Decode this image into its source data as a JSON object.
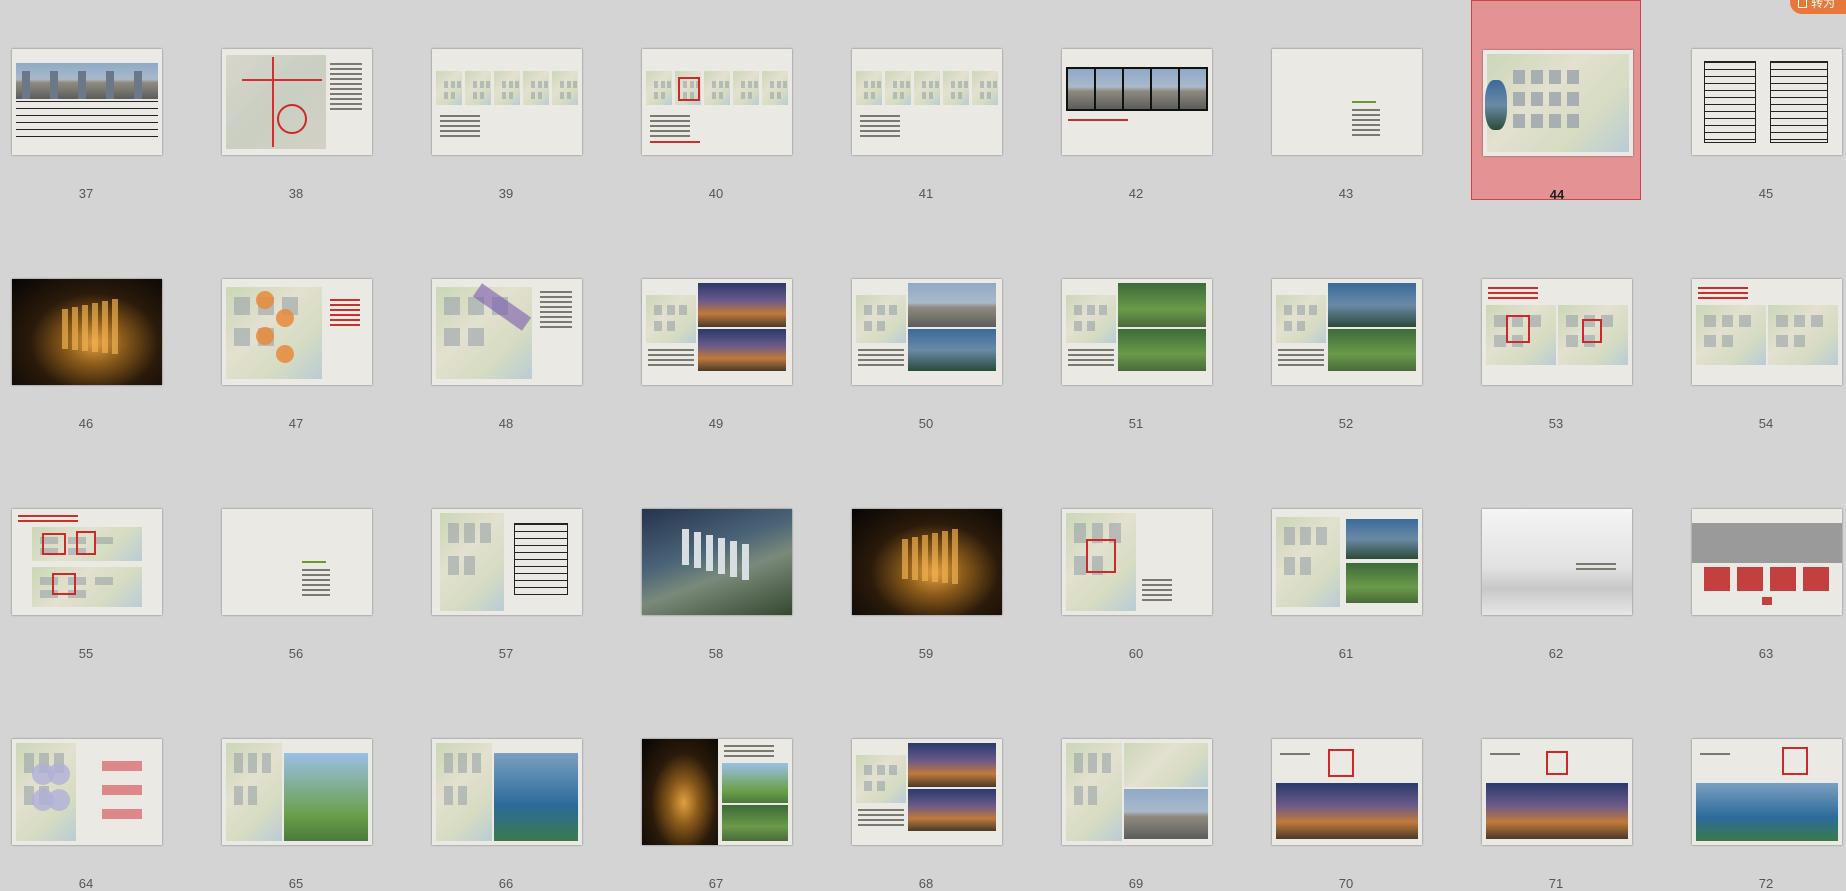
{
  "corner_button": {
    "label": "转为"
  },
  "selected_slide": "44",
  "slides": [
    {
      "number": "37",
      "kind": "towers-table"
    },
    {
      "number": "38",
      "kind": "road-map"
    },
    {
      "number": "39",
      "kind": "plan-strip"
    },
    {
      "number": "40",
      "kind": "plan-strip-red"
    },
    {
      "number": "41",
      "kind": "plan-strip"
    },
    {
      "number": "42",
      "kind": "towers-strip"
    },
    {
      "number": "43",
      "kind": "title-blank"
    },
    {
      "number": "44",
      "kind": "site-plan"
    },
    {
      "number": "45",
      "kind": "data-tables"
    },
    {
      "number": "46",
      "kind": "night-render"
    },
    {
      "number": "47",
      "kind": "diagram-circles"
    },
    {
      "number": "48",
      "kind": "diagram-arrows"
    },
    {
      "number": "49",
      "kind": "plan-photos-dusk"
    },
    {
      "number": "50",
      "kind": "plan-photos-water"
    },
    {
      "number": "51",
      "kind": "plan-photos-palms"
    },
    {
      "number": "52",
      "kind": "plan-photos-lake"
    },
    {
      "number": "53",
      "kind": "two-plans-red"
    },
    {
      "number": "54",
      "kind": "two-plans"
    },
    {
      "number": "55",
      "kind": "red-outline-plans"
    },
    {
      "number": "56",
      "kind": "title-blank"
    },
    {
      "number": "57",
      "kind": "plan-with-table"
    },
    {
      "number": "58",
      "kind": "aerial-render"
    },
    {
      "number": "59",
      "kind": "night-render"
    },
    {
      "number": "60",
      "kind": "plan-legend"
    },
    {
      "number": "61",
      "kind": "plan-photos-garden"
    },
    {
      "number": "62",
      "kind": "fog-title"
    },
    {
      "number": "63",
      "kind": "flow-diagram"
    },
    {
      "number": "64",
      "kind": "bubble-plan"
    },
    {
      "number": "65",
      "kind": "plan-photos-sport"
    },
    {
      "number": "66",
      "kind": "plan-photos-court"
    },
    {
      "number": "67",
      "kind": "night-plaza"
    },
    {
      "number": "68",
      "kind": "plan-photos-dusk"
    },
    {
      "number": "69",
      "kind": "plan-photos-towers"
    },
    {
      "number": "70",
      "kind": "red-entrance"
    },
    {
      "number": "71",
      "kind": "red-entrance-night"
    },
    {
      "number": "72",
      "kind": "red-entrance-pool"
    }
  ]
}
